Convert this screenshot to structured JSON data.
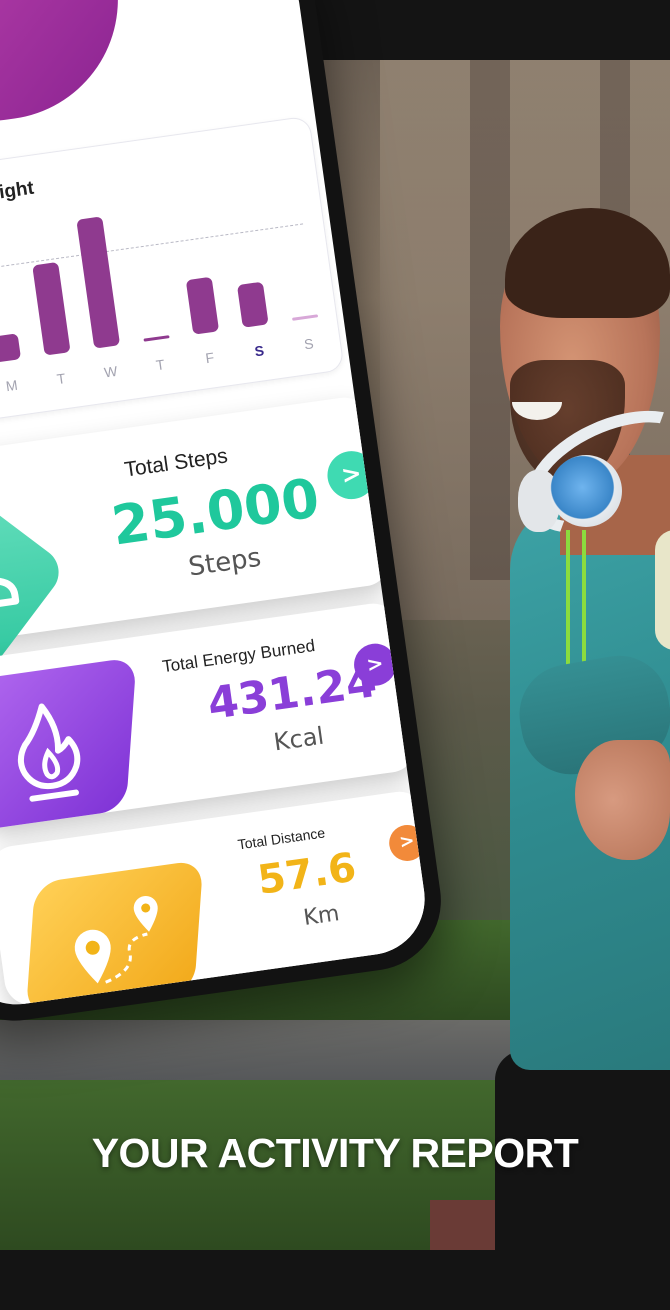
{
  "insight": {
    "title": "Insight",
    "days": [
      "M",
      "T",
      "W",
      "T",
      "F",
      "S",
      "S"
    ],
    "active_day_index": 5,
    "bar_levels": [
      0.2,
      0.7,
      1.0,
      0.02,
      0.42,
      0.33,
      0.02
    ],
    "bar_color": "#8f3a8f"
  },
  "steps": {
    "title": "Total Steps",
    "value": "25.000",
    "unit": "Steps",
    "color": "#1fc89c",
    "arrow": ">",
    "icon": "shoe-icon"
  },
  "energy": {
    "title": "Total Energy Burned",
    "value": "431.24",
    "unit": "Kcal",
    "color": "#8a3ed8",
    "arrow": ">",
    "icon": "flame-icon"
  },
  "distance": {
    "title": "Total Distance",
    "value": "57.6",
    "unit": "Km",
    "color": "#f2b418",
    "arrow": ">",
    "icon": "map-pin-route-icon"
  },
  "caption": "YOUR ACTIVITY REPORT"
}
